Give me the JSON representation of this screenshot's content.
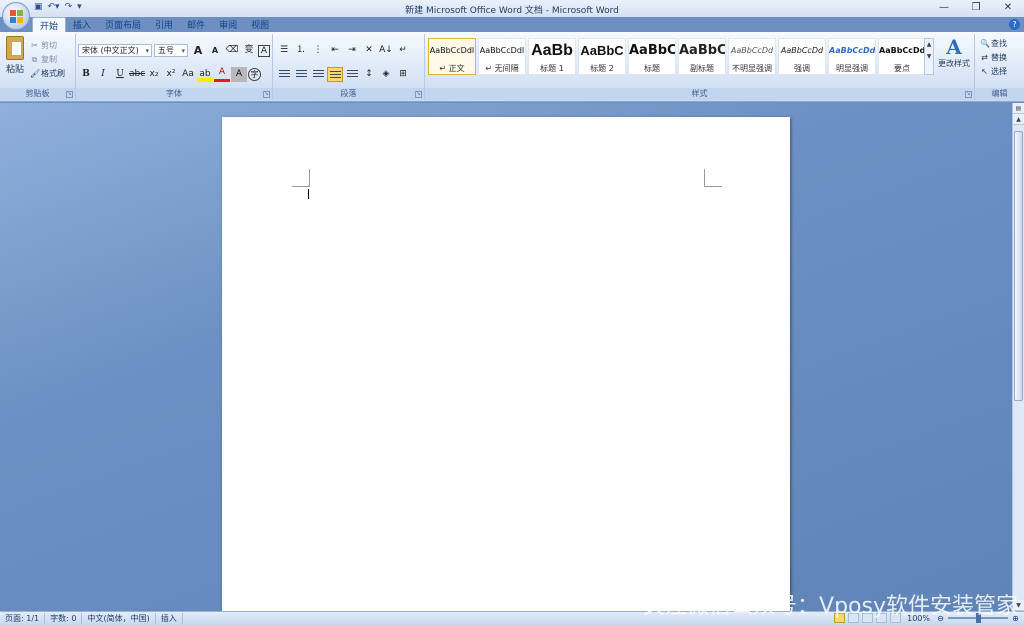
{
  "window": {
    "title": "新建 Microsoft Office Word 文档 - Microsoft Word"
  },
  "qat": {
    "save_icon": "save-icon",
    "undo_icon": "undo-icon",
    "redo_icon": "redo-icon",
    "customize_icon": "customize-icon"
  },
  "tabs": [
    {
      "label": "开始",
      "active": true
    },
    {
      "label": "插入"
    },
    {
      "label": "页面布局"
    },
    {
      "label": "引用"
    },
    {
      "label": "邮件"
    },
    {
      "label": "审阅"
    },
    {
      "label": "视图"
    }
  ],
  "clipboard": {
    "paste_label": "粘贴",
    "cut_label": "剪切",
    "copy_label": "复制",
    "format_painter_label": "格式刷",
    "group_label": "剪贴板"
  },
  "font": {
    "font_name": "宋体 (中文正文)",
    "font_size": "五号",
    "grow": "A",
    "shrink": "A",
    "bold": "B",
    "italic": "I",
    "underline": "U",
    "strike": "abc",
    "subscript": "x₂",
    "superscript": "x²",
    "change_case": "Aa",
    "highlight": "ab",
    "font_color": "A",
    "char_shade": "A",
    "enclose": "字",
    "phonetic": "变",
    "border_char": "A",
    "group_label": "字体"
  },
  "paragraph": {
    "group_label": "段落",
    "sort": "A↓",
    "pilcrow": "↵"
  },
  "styles": {
    "group_label": "样式",
    "items": [
      {
        "sample": "AaBbCcDdI",
        "name": "↵ 正文"
      },
      {
        "sample": "AaBbCcDdI",
        "name": "↵ 无间隔"
      },
      {
        "sample": "AaBb",
        "name": "标题 1"
      },
      {
        "sample": "AaBbC",
        "name": "标题 2"
      },
      {
        "sample": "AaBbC",
        "name": "标题"
      },
      {
        "sample": "AaBbC",
        "name": "副标题"
      },
      {
        "sample": "AaBbCcDd",
        "name": "不明显强调"
      },
      {
        "sample": "AaBbCcDd",
        "name": "强调"
      },
      {
        "sample": "AaBbCcDd",
        "name": "明显强调"
      },
      {
        "sample": "AaBbCcDd",
        "name": "要点"
      }
    ],
    "change_styles_label": "更改样式",
    "change_styles_glyph": "A"
  },
  "editing": {
    "group_label": "编辑",
    "find_label": "查找",
    "replace_label": "替换",
    "select_label": "选择"
  },
  "status": {
    "page": "页面: 1/1",
    "words": "字数: 0",
    "language": "中文(简体，中国)",
    "mode": "插入",
    "zoom": "100%"
  },
  "watermark": "关注微信公众号：Vposy软件安装管家",
  "colors": {
    "accent": "#2b6cc4",
    "workspace": "#6d8fc1",
    "highlight": "#ffee00",
    "font_color": "#e02020"
  }
}
